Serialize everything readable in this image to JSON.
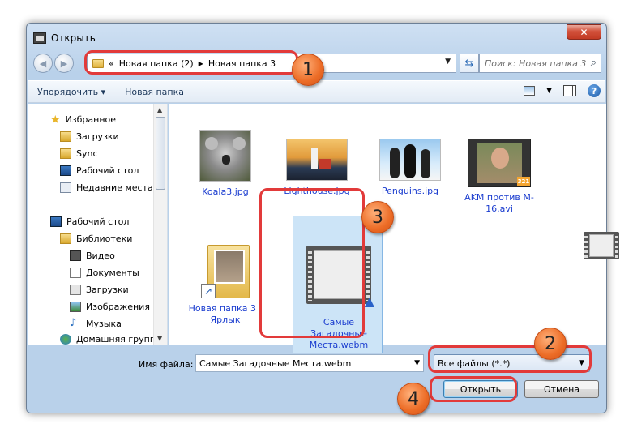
{
  "window": {
    "title": "Открыть",
    "close_glyph": "✕"
  },
  "nav": {
    "back": "◀",
    "forward": "▶",
    "breadcrumb_prefix": "«",
    "path": [
      "Новая папка (2)",
      "Новая папка 3"
    ],
    "separator": "▶",
    "search_placeholder": "Поиск: Новая папка 3"
  },
  "toolbar": {
    "organize": "Упорядочить ▾",
    "new_folder": "Новая папка"
  },
  "sidebar": {
    "favorites_header": "Избранное",
    "favorites": [
      "Загрузки",
      "Sync",
      "Рабочий стол",
      "Недавние места"
    ],
    "desktop_header": "Рабочий стол",
    "libraries_header": "Библиотеки",
    "libraries": [
      "Видео",
      "Документы",
      "Загрузки",
      "Изображения",
      "Музыка"
    ],
    "homegroup": "Домашняя группа"
  },
  "files": [
    {
      "name": "Koala3.jpg"
    },
    {
      "name": "Lighthouse.jpg"
    },
    {
      "name": "Penguins.jpg"
    },
    {
      "name": "AKM против M-16.avi"
    },
    {
      "name": "Новая папка 3 - Ярлык"
    },
    {
      "name": "Самые Загадочные Места.webm",
      "selected": true
    }
  ],
  "footer": {
    "filename_label": "Имя файла:",
    "filename_value": "Самые Загадочные Места.webm",
    "filetype_value": "Все файлы (*.*)",
    "open_button": "Открыть",
    "cancel_button": "Отмена"
  },
  "callouts": [
    "1",
    "2",
    "3",
    "4"
  ],
  "colors": {
    "callout": "#ec6c26",
    "highlight_ring": "#e23a3a",
    "selection": "#cce4f7",
    "link_text": "#1a3ccf"
  }
}
